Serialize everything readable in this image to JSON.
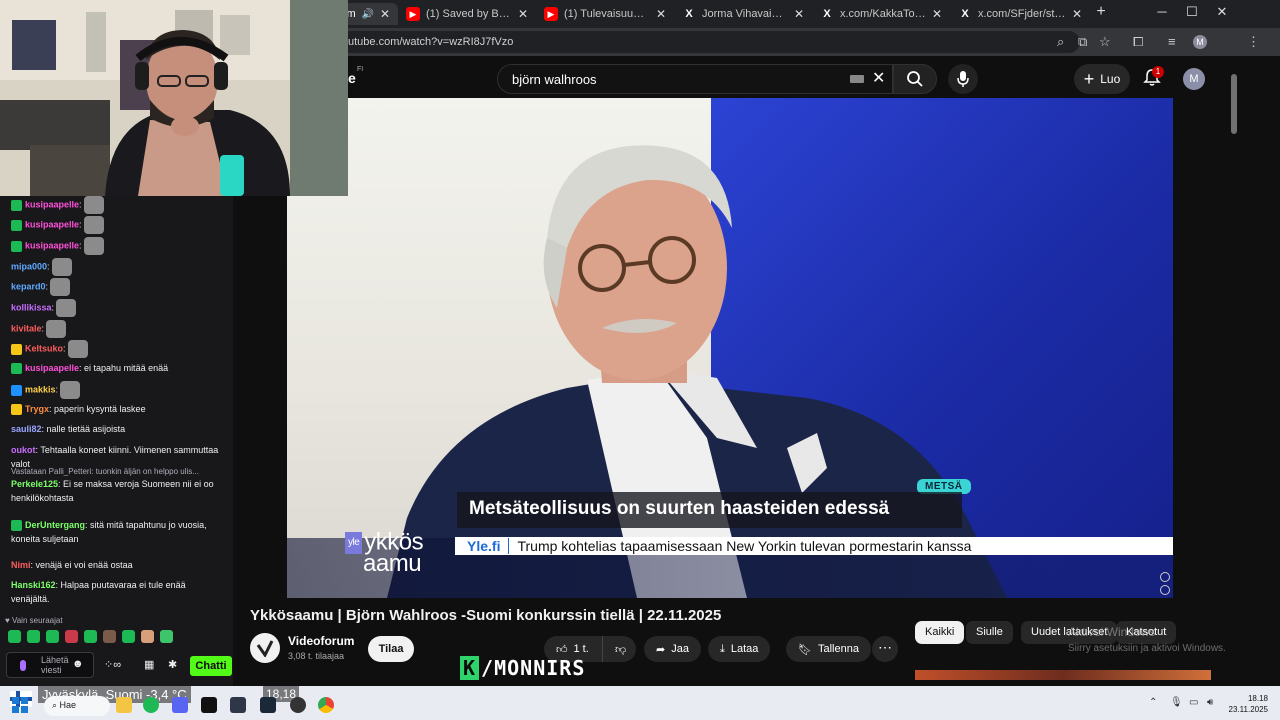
{
  "browser": {
    "tabs": [
      {
        "label": "(1) Saved by Bodyguards",
        "icon": "youtube"
      },
      {
        "label": "(1) Tulevaisuuden tavoite",
        "icon": "youtube"
      },
      {
        "label": "Jorma Vihavainen Xssä:",
        "icon": "x"
      },
      {
        "label": "x.com/KakkaToveri/status",
        "icon": "x"
      },
      {
        "label": "x.com/SFjder/status/1990",
        "icon": "x"
      }
    ],
    "first_tab_fragment": "im",
    "new_tab": "+",
    "url": "utube.com/watch?v=wzRI8J7fVzo",
    "profile_initial": "M"
  },
  "youtube": {
    "logo_fragment": "e",
    "logo_region": "FI",
    "search_value": "björn walhroos",
    "create_label": "Luo",
    "notification_count": "1",
    "avatar_initial": "M",
    "video": {
      "tag": "METSÄ",
      "headline": "Metsäteollisuus on suurten haasteiden edessä",
      "ticker_source": "Yle.fi",
      "ticker_text": "Trump kohtelias tapaamisessaan New Yorkin tulevan pormestarin kanssa",
      "logo_brand": "yle",
      "logo_line1": "ykkös",
      "logo_line2": "aamu"
    },
    "title": "Ykkösaamu | Björn Wahlroos -Suomi konkurssin tiellä | 22.11.2025",
    "channel": {
      "name": "Videoforum",
      "subs": "3,08 t. tilaajaa"
    },
    "subscribe_label": "Tilaa",
    "actions": {
      "likes": "1 t.",
      "share": "Jaa",
      "download": "Lataa",
      "save": "Tallenna"
    },
    "chips": [
      "Kaikki",
      "Siulle",
      "Uudet lataukset",
      "Katsotut"
    ],
    "windows_watermark": {
      "line1": "Aktivoi Windows",
      "line2": "Siirry asetuksiin ja aktivoi Windows."
    },
    "overlay_brand": "/MONNIRS",
    "overlay_brand_k": "K"
  },
  "chat": {
    "messages": [
      {
        "user": "kusipaapelle",
        "color": "#ff4fd8",
        "text": ":",
        "emote": true,
        "badge": "#1db954"
      },
      {
        "user": "kusipaapelle",
        "color": "#ff4fd8",
        "text": ":",
        "emote": true,
        "badge": "#1db954"
      },
      {
        "user": "kusipaapelle",
        "color": "#ff4fd8",
        "text": ":",
        "emote": true,
        "badge": "#1db954"
      },
      {
        "user": "mipa000",
        "color": "#5fa8ff",
        "text": ":",
        "emote": true
      },
      {
        "user": "kepard0",
        "color": "#5fa8ff",
        "text": ":",
        "emote": true
      },
      {
        "user": "kollikissa",
        "color": "#c86dff",
        "text": ":",
        "emote": true
      },
      {
        "user": "kivitale",
        "color": "#ff5d5d",
        "text": ":",
        "emote": true
      },
      {
        "user": "Keltsuko",
        "color": "#ff5d5d",
        "text": ":",
        "emote": true,
        "badge": "#f5c518"
      },
      {
        "user": "kusipaapelle",
        "color": "#ff4fd8",
        "text": ": ei tapahu mitää enää",
        "badge": "#1db954"
      },
      {
        "user": "makkis",
        "color": "#ffd24a",
        "text": ":",
        "emote": true,
        "badge": "#1e90ff"
      },
      {
        "user": "Trygx",
        "color": "#ff8c3a",
        "text": ": paperin kysyntä laskee",
        "badge": "#f5c518"
      },
      {
        "user": "sauli82",
        "color": "#9aa6ff",
        "text": ": nalle tietää asijoista"
      },
      {
        "user": "oukot",
        "color": "#c86dff",
        "text": ": Tehtaalla koneet kiinni. Viimenen sammuttaa valot"
      },
      {
        "user": "Perkele125",
        "color": "#7dff6a",
        "text": ": Ei se maksa veroja Suomeen nii ei oo henkilökohtasta",
        "reply": "Vastataan Palli_Petteri: tuonkin äljän on helppo ulis..."
      },
      {
        "user": "DerUntergang",
        "color": "#7dff6a",
        "text": ": sitä mitä tapahtunu jo vuosia, koneita suljetaan",
        "badge": "#1db954"
      },
      {
        "user": "Nimi",
        "color": "#ff5d5d",
        "text": ": venäjä ei voi enää ostaa"
      },
      {
        "user": "Hanski162",
        "color": "#7dff6a",
        "text": ": Halpaa puutavaraa ei tule enää venäjältä."
      }
    ],
    "followers_only": "Vain seuraajat",
    "input_placeholder": "Lähetä viesti",
    "send_label": "Chatti"
  },
  "taskbar": {
    "weather": "Jyväskylä, Suomi  -3,4 °C",
    "temperature_short": "18,18",
    "search": "Hae",
    "time": "18.18",
    "date": "23.11.2025"
  }
}
